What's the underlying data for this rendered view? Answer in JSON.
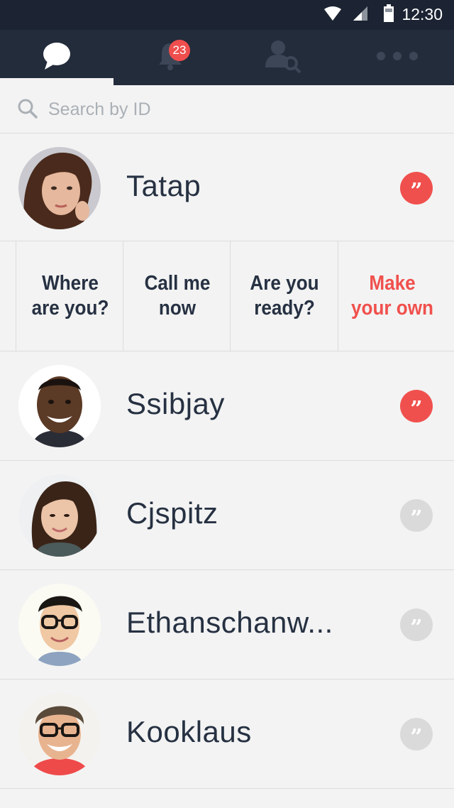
{
  "status_bar": {
    "time": "12:30",
    "icons": [
      "wifi-icon",
      "signal-icon",
      "battery-icon"
    ]
  },
  "tabs": [
    {
      "name": "chats",
      "icon": "chat-bubble-icon",
      "active": true
    },
    {
      "name": "notifications",
      "icon": "bell-icon",
      "badge": "23"
    },
    {
      "name": "find-friends",
      "icon": "user-search-icon"
    },
    {
      "name": "more",
      "icon": "more-dots-icon"
    }
  ],
  "search": {
    "placeholder": "Search by ID"
  },
  "quick_replies": [
    {
      "label": "Where are you?"
    },
    {
      "label": "Call me now"
    },
    {
      "label": "Are you ready?"
    },
    {
      "label": "Make your own",
      "accent": true
    }
  ],
  "contacts": [
    {
      "name": "Tatap",
      "quote_active": true
    },
    {
      "name": "Ssibjay",
      "quote_active": true
    },
    {
      "name": "Cjspitz",
      "quote_active": false
    },
    {
      "name": "Ethanschanw...",
      "quote_active": false
    },
    {
      "name": "Kooklaus",
      "quote_active": false
    }
  ],
  "quote_glyph": "”",
  "colors": {
    "header_bg": "#232c3b",
    "status_bg": "#1c2433",
    "accent": "#f0504d",
    "text": "#263142",
    "muted": "#aab0b6"
  }
}
